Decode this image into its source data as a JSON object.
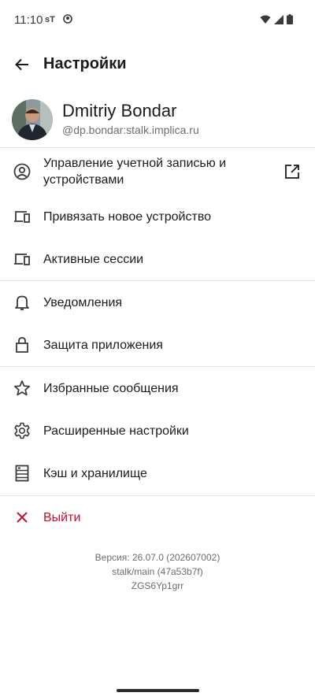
{
  "status": {
    "time": "11:10",
    "carrier": "sT"
  },
  "header": {
    "title": "Настройки"
  },
  "profile": {
    "name": "Dmitriy Bondar",
    "id": "@dp.bondar:stalk.implica.ru"
  },
  "menu": {
    "account": "Управление учетной записью и устройствами",
    "link_device": "Привязать новое устройство",
    "sessions": "Активные сессии",
    "notifications": "Уведомления",
    "app_lock": "Защита приложения",
    "favorites": "Избранные сообщения",
    "advanced": "Расширенные настройки",
    "cache": "Кэш и хранилище",
    "logout": "Выйти"
  },
  "version": {
    "line1": "Версия: 26.07.0 (202607002)",
    "line2": "stalk/main (47a53b7f)",
    "line3": "ZGS6Yp1grr"
  },
  "colors": {
    "accent_red": "#c8102e",
    "text": "#1b1b1f",
    "muted": "#6b6b72"
  }
}
